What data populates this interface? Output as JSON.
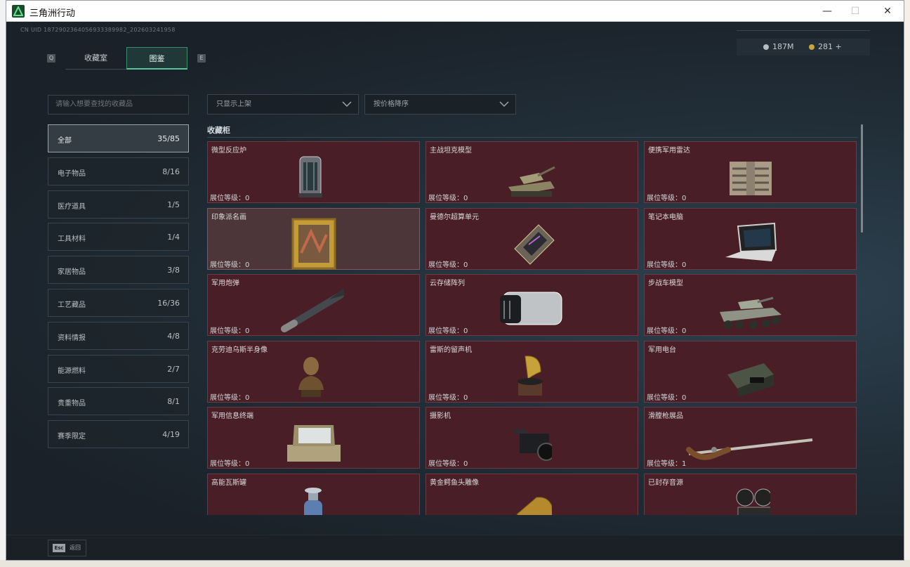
{
  "window": {
    "title": "三角洲行动",
    "minimize": "—",
    "maximize": "☐",
    "close": "✕"
  },
  "header": {
    "uid": "CN UID 1872902364056933389982_202603241958",
    "currency": [
      {
        "value": "187M",
        "color": "#b7bcc0"
      },
      {
        "value": "281 +",
        "color": "#c9a33b"
      }
    ],
    "key_left": "Q",
    "key_right": "E",
    "tabs": [
      {
        "label": "收藏室",
        "active": false
      },
      {
        "label": "图鉴",
        "active": true
      }
    ]
  },
  "sidebar": {
    "search_placeholder": "请输入想要查找的收藏品",
    "categories": [
      {
        "label": "全部",
        "count": "35/85",
        "active": true
      },
      {
        "label": "电子物品",
        "count": "8/16"
      },
      {
        "label": "医疗道具",
        "count": "1/5"
      },
      {
        "label": "工具材料",
        "count": "1/4"
      },
      {
        "label": "家居物品",
        "count": "3/8"
      },
      {
        "label": "工艺藏品",
        "count": "16/36"
      },
      {
        "label": "资料情报",
        "count": "4/8"
      },
      {
        "label": "能源燃料",
        "count": "2/7"
      },
      {
        "label": "贵重物品",
        "count": "8/1"
      },
      {
        "label": "赛季限定",
        "count": "4/19"
      }
    ]
  },
  "filters": {
    "shelf": "只显示上架",
    "sort": "按价格降序"
  },
  "section_title": "收藏柜",
  "level_prefix": "展位等级：",
  "items": [
    {
      "name": "微型反应炉",
      "level": "0",
      "icon": "reactor-icon"
    },
    {
      "name": "主战坦克模型",
      "level": "0",
      "icon": "tank-icon"
    },
    {
      "name": "便携军用雷达",
      "level": "0",
      "icon": "radar-icon"
    },
    {
      "name": "印象派名画",
      "level": "0",
      "icon": "painting-icon",
      "highlight": true
    },
    {
      "name": "曼德尔超算单元",
      "level": "0",
      "icon": "chip-icon"
    },
    {
      "name": "笔记本电脑",
      "level": "0",
      "icon": "laptop-icon"
    },
    {
      "name": "军用炮弹",
      "level": "0",
      "icon": "shell-icon"
    },
    {
      "name": "云存储阵列",
      "level": "0",
      "icon": "storage-icon"
    },
    {
      "name": "步战车模型",
      "level": "0",
      "icon": "ifv-icon"
    },
    {
      "name": "克劳迪乌斯半身像",
      "level": "0",
      "icon": "bust-icon"
    },
    {
      "name": "雷斯的留声机",
      "level": "0",
      "icon": "gramophone-icon"
    },
    {
      "name": "军用电台",
      "level": "0",
      "icon": "radio-icon"
    },
    {
      "name": "军用信息终端",
      "level": "0",
      "icon": "terminal-icon"
    },
    {
      "name": "摄影机",
      "level": "0",
      "icon": "camera-icon"
    },
    {
      "name": "滑膛枪展品",
      "level": "1",
      "icon": "musket-icon"
    },
    {
      "name": "高能瓦斯罐",
      "level": "",
      "icon": "gas-tank-icon"
    },
    {
      "name": "黄金鳄鱼头雕像",
      "level": "",
      "icon": "croc-statue-icon"
    },
    {
      "name": "已封存音源",
      "level": "",
      "icon": "reel-recorder-icon"
    }
  ],
  "footer": {
    "esc_key": "Esc",
    "esc_label": "返回"
  }
}
